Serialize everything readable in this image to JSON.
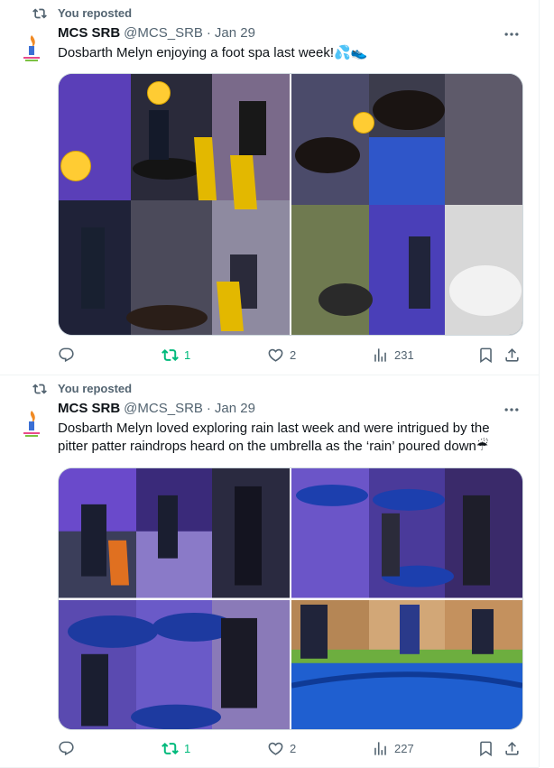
{
  "feed": {
    "tweets": [
      {
        "repost_label": "You reposted",
        "author_name": "MCS SRB",
        "author_handle": "@MCS_SRB",
        "separator": "·",
        "date": "Jan 29",
        "text": "Dosbarth Melyn enjoying a foot spa last week!💦👟",
        "images": [
          {
            "alt": "children with feet in foot spa trays"
          },
          {
            "alt": "close up of feet in water and sand"
          }
        ],
        "actions": {
          "replies": "",
          "reposts": "1",
          "likes": "2",
          "views": "231"
        }
      },
      {
        "repost_label": "You reposted",
        "author_name": "MCS SRB",
        "author_handle": "@MCS_SRB",
        "separator": "·",
        "date": "Jan 29",
        "text": "Dosbarth Melyn loved exploring rain last week and were intrigued by the pitter patter raindrops heard on the umbrella as the ‘rain’ poured down☔",
        "images": [
          {
            "alt": "children under purple light"
          },
          {
            "alt": "children with umbrellas"
          },
          {
            "alt": "child holding blue umbrella"
          },
          {
            "alt": "outdoor umbrella play on grass"
          }
        ],
        "actions": {
          "replies": "",
          "reposts": "1",
          "likes": "2",
          "views": "227"
        }
      }
    ]
  },
  "colors": {
    "accent_green": "#00ba7c",
    "muted": "#536471",
    "text": "#0f1419",
    "divider": "#eff3f4"
  },
  "icons": [
    "repost-icon",
    "more-icon",
    "reply-icon",
    "like-icon",
    "views-icon",
    "bookmark-icon",
    "share-icon"
  ]
}
